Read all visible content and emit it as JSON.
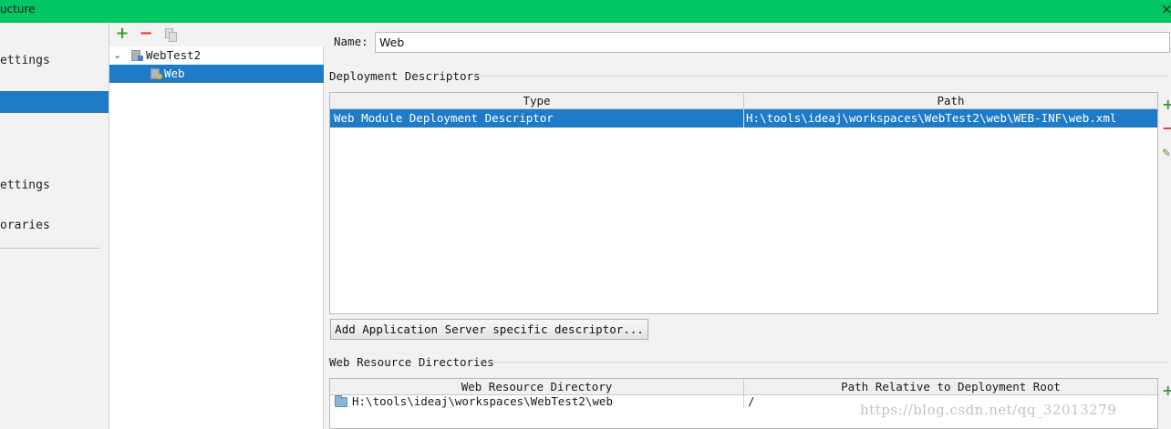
{
  "window": {
    "title": "ucture"
  },
  "nav": {
    "items": [
      {
        "label": "ettings",
        "selected": false
      },
      {
        "label": "",
        "selected": true
      },
      {
        "label": "ettings",
        "selected": false
      },
      {
        "label": "oraries",
        "selected": false
      }
    ]
  },
  "tree_toolbar": {
    "add": "+",
    "remove": "−"
  },
  "tree": {
    "root": {
      "label": "WebTest2",
      "expanded": true
    },
    "child": {
      "label": "Web",
      "selected": true
    }
  },
  "form": {
    "name_label": "Name:",
    "name_value": "Web"
  },
  "deployment_descriptors": {
    "title": "Deployment Descriptors",
    "columns": [
      "Type",
      "Path"
    ],
    "rows": [
      {
        "type": "Web Module Deployment Descriptor",
        "path": "H:\\tools\\ideaj\\workspaces\\WebTest2\\web\\WEB-INF\\web.xml",
        "selected": true
      }
    ],
    "add_server_button": "Add Application Server specific descriptor..."
  },
  "web_resource_directories": {
    "title": "Web Resource Directories",
    "columns": [
      "Web Resource Directory",
      "Path Relative to Deployment Root"
    ],
    "rows": [
      {
        "directory": "H:\\tools\\ideaj\\workspaces\\WebTest2\\web",
        "relative_path": "/"
      }
    ]
  },
  "side_tools": {
    "add": "+",
    "remove": "−",
    "edit": "✎"
  },
  "watermark": "https://blog.csdn.net/qq_32013279",
  "colors": {
    "titlebar": "#00c764",
    "selection": "#1e7bc8",
    "add_green": "#3aa13a",
    "remove_red": "#d83a3a"
  }
}
